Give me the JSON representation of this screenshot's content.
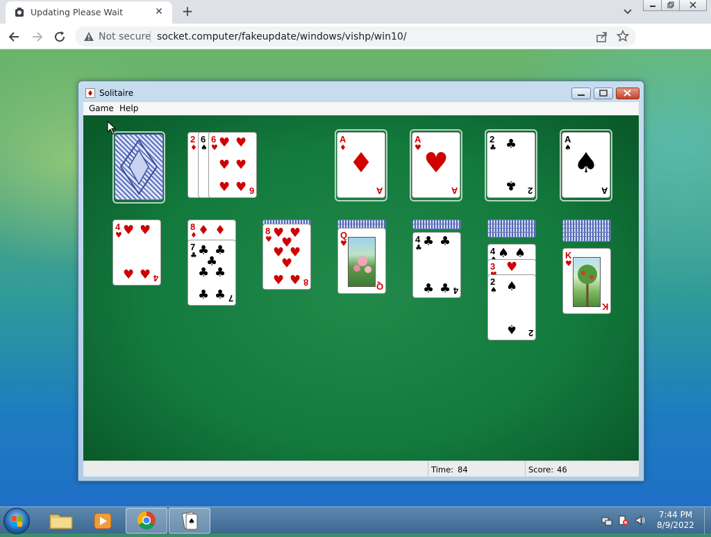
{
  "browser": {
    "tab_title": "Updating Please Wait",
    "security_label": "Not secure",
    "url": "socket.computer/fakeupdate/windows/vishp/win10/",
    "accent": "#1a73e8"
  },
  "window": {
    "title": "Solitaire",
    "menu": [
      "Game",
      "Help"
    ]
  },
  "status": {
    "time_label": "Time:",
    "time_value": "84",
    "score_label": "Score:",
    "score_value": "46"
  },
  "cards": {
    "waste": [
      {
        "rank": "2",
        "suit": "♦",
        "color": "red"
      },
      {
        "rank": "6",
        "suit": "♠",
        "color": "black"
      },
      {
        "rank": "6",
        "suit": "♥",
        "color": "red"
      }
    ],
    "foundations": [
      {
        "rank": "A",
        "suit": "♦",
        "color": "red"
      },
      {
        "rank": "A",
        "suit": "♥",
        "color": "red"
      },
      {
        "rank": "2",
        "suit": "♣",
        "color": "black"
      },
      {
        "rank": "A",
        "suit": "♠",
        "color": "black"
      }
    ],
    "tableau": [
      {
        "down": 0,
        "up": [
          {
            "rank": "4",
            "suit": "♥",
            "color": "red"
          }
        ]
      },
      {
        "down": 0,
        "up": [
          {
            "rank": "8",
            "suit": "♦",
            "color": "red"
          },
          {
            "rank": "7",
            "suit": "♣",
            "color": "black"
          }
        ]
      },
      {
        "down": 1,
        "up": [
          {
            "rank": "8",
            "suit": "♥",
            "color": "red"
          }
        ]
      },
      {
        "down": 2,
        "up": [
          {
            "rank": "Q",
            "suit": "♥",
            "color": "red",
            "face": true
          }
        ]
      },
      {
        "down": 2,
        "up": [
          {
            "rank": "4",
            "suit": "♣",
            "color": "black"
          }
        ]
      },
      {
        "down": 4,
        "up": [
          {
            "rank": "4",
            "suit": "♠",
            "color": "black"
          },
          {
            "rank": "3",
            "suit": "♥",
            "color": "red"
          },
          {
            "rank": "2",
            "suit": "♠",
            "color": "black"
          }
        ]
      },
      {
        "down": 5,
        "up": [
          {
            "rank": "K",
            "suit": "♥",
            "color": "red",
            "face": true
          }
        ]
      }
    ]
  },
  "clock": {
    "time": "7:44 PM",
    "date": "8/9/2022"
  }
}
